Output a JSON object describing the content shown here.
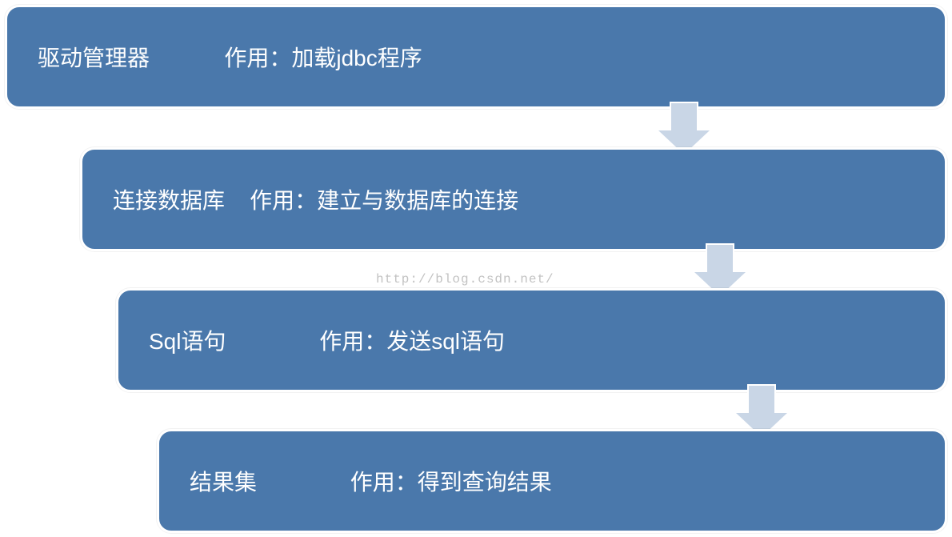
{
  "watermark": "http://blog.csdn.net/",
  "steps": [
    {
      "title": "驱动管理器",
      "gap": "            ",
      "role_label": "作用：",
      "role": "加载jdbc程序"
    },
    {
      "title": "连接数据库",
      "gap": "    ",
      "role_label": "作用：",
      "role": "建立与数据库的连接"
    },
    {
      "title": "Sql语句",
      "gap": "               ",
      "role_label": "作用：",
      "role": "发送sql语句"
    },
    {
      "title": "结果集",
      "gap": "               ",
      "role_label": "作用：",
      "role": "得到查询结果"
    }
  ]
}
